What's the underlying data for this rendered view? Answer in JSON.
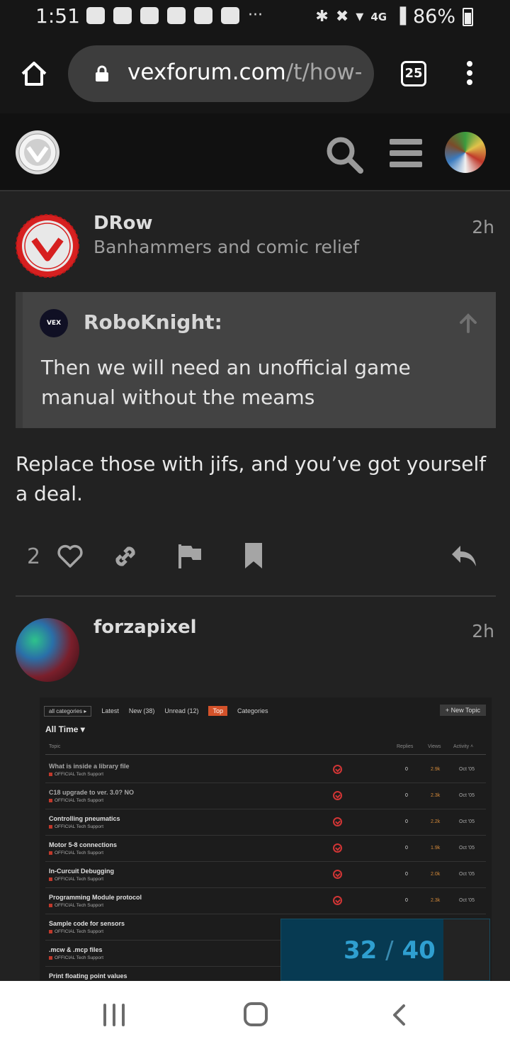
{
  "status_bar": {
    "time": "1:51",
    "more_indicator": "···",
    "network": "4G",
    "battery": "86%"
  },
  "browser": {
    "url_domain": "vexforum.com",
    "url_path": "/t/how-a",
    "tab_count": "25"
  },
  "post1": {
    "username": "DRow",
    "user_title": "Banhammers and comic relief",
    "time": "2h",
    "quote": {
      "author": "RoboKnight:",
      "avatar_text": "VEX",
      "text": "Then we will need an unofficial game manual without the meams"
    },
    "body": "Replace those with jifs, and you’ve got yourself a deal.",
    "like_count": "2"
  },
  "post2": {
    "username": "forzapixel",
    "time": "2h"
  },
  "embed": {
    "nav": {
      "categories_dropdown": "all categories ▸",
      "latest": "Latest",
      "new": "New (38)",
      "unread": "Unread (12)",
      "top": "Top",
      "categories": "Categories"
    },
    "new_topic": "+ New Topic",
    "period": "All Time ▾",
    "headers": {
      "topic": "Topic",
      "replies": "Replies",
      "views": "Views",
      "activity": "Activity ˄"
    },
    "rows": [
      {
        "title": "What is inside a library file",
        "category": "OFFICIAL Tech Support",
        "replies": "0",
        "views": "2.9k",
        "activity": "Oct '05",
        "badge": true,
        "dim": true
      },
      {
        "title": "C18 upgrade to ver. 3.0? NO",
        "category": "OFFICIAL Tech Support",
        "replies": "0",
        "views": "2.3k",
        "activity": "Oct '05",
        "badge": true,
        "dim": true
      },
      {
        "title": "Controlling pneumatics",
        "category": "OFFICIAL Tech Support",
        "replies": "0",
        "views": "2.2k",
        "activity": "Oct '05",
        "badge": true,
        "dim": false
      },
      {
        "title": "Motor 5-8 connections",
        "category": "OFFICIAL Tech Support",
        "replies": "0",
        "views": "1.9k",
        "activity": "Oct '05",
        "badge": true,
        "dim": false
      },
      {
        "title": "In-Curcuit Debugging",
        "category": "OFFICIAL Tech Support",
        "replies": "0",
        "views": "2.0k",
        "activity": "Oct '05",
        "badge": true,
        "dim": false
      },
      {
        "title": "Programming Module protocol",
        "category": "OFFICIAL Tech Support",
        "replies": "0",
        "views": "2.3k",
        "activity": "Oct '05",
        "badge": true,
        "dim": false
      },
      {
        "title": "Sample code for sensors",
        "category": "OFFICIAL Tech Support",
        "replies": "",
        "views": "",
        "activity": "",
        "badge": false,
        "dim": false
      },
      {
        "title": ".mcw & .mcp files",
        "category": "OFFICIAL Tech Support",
        "replies": "",
        "views": "",
        "activity": "",
        "badge": false,
        "dim": false
      },
      {
        "title": "Print floating point values",
        "category": "",
        "replies": "",
        "views": "",
        "activity": "",
        "badge": false,
        "dim": false
      }
    ]
  },
  "progress": {
    "current": "32",
    "separator": "/",
    "total": "40",
    "fraction": 0.78
  },
  "colors": {
    "accent_red": "#d03535",
    "top_tab": "#d4522a",
    "progress_text": "#2f9fd0",
    "views_orange": "#d58a3a"
  },
  "icons": [
    "home-icon",
    "lock-icon",
    "search-icon",
    "hamburger-icon",
    "arrow-up-icon",
    "heart-icon",
    "link-icon",
    "flag-icon",
    "bookmark-icon",
    "reply-icon",
    "recents-icon",
    "home-nav-icon",
    "back-icon"
  ]
}
